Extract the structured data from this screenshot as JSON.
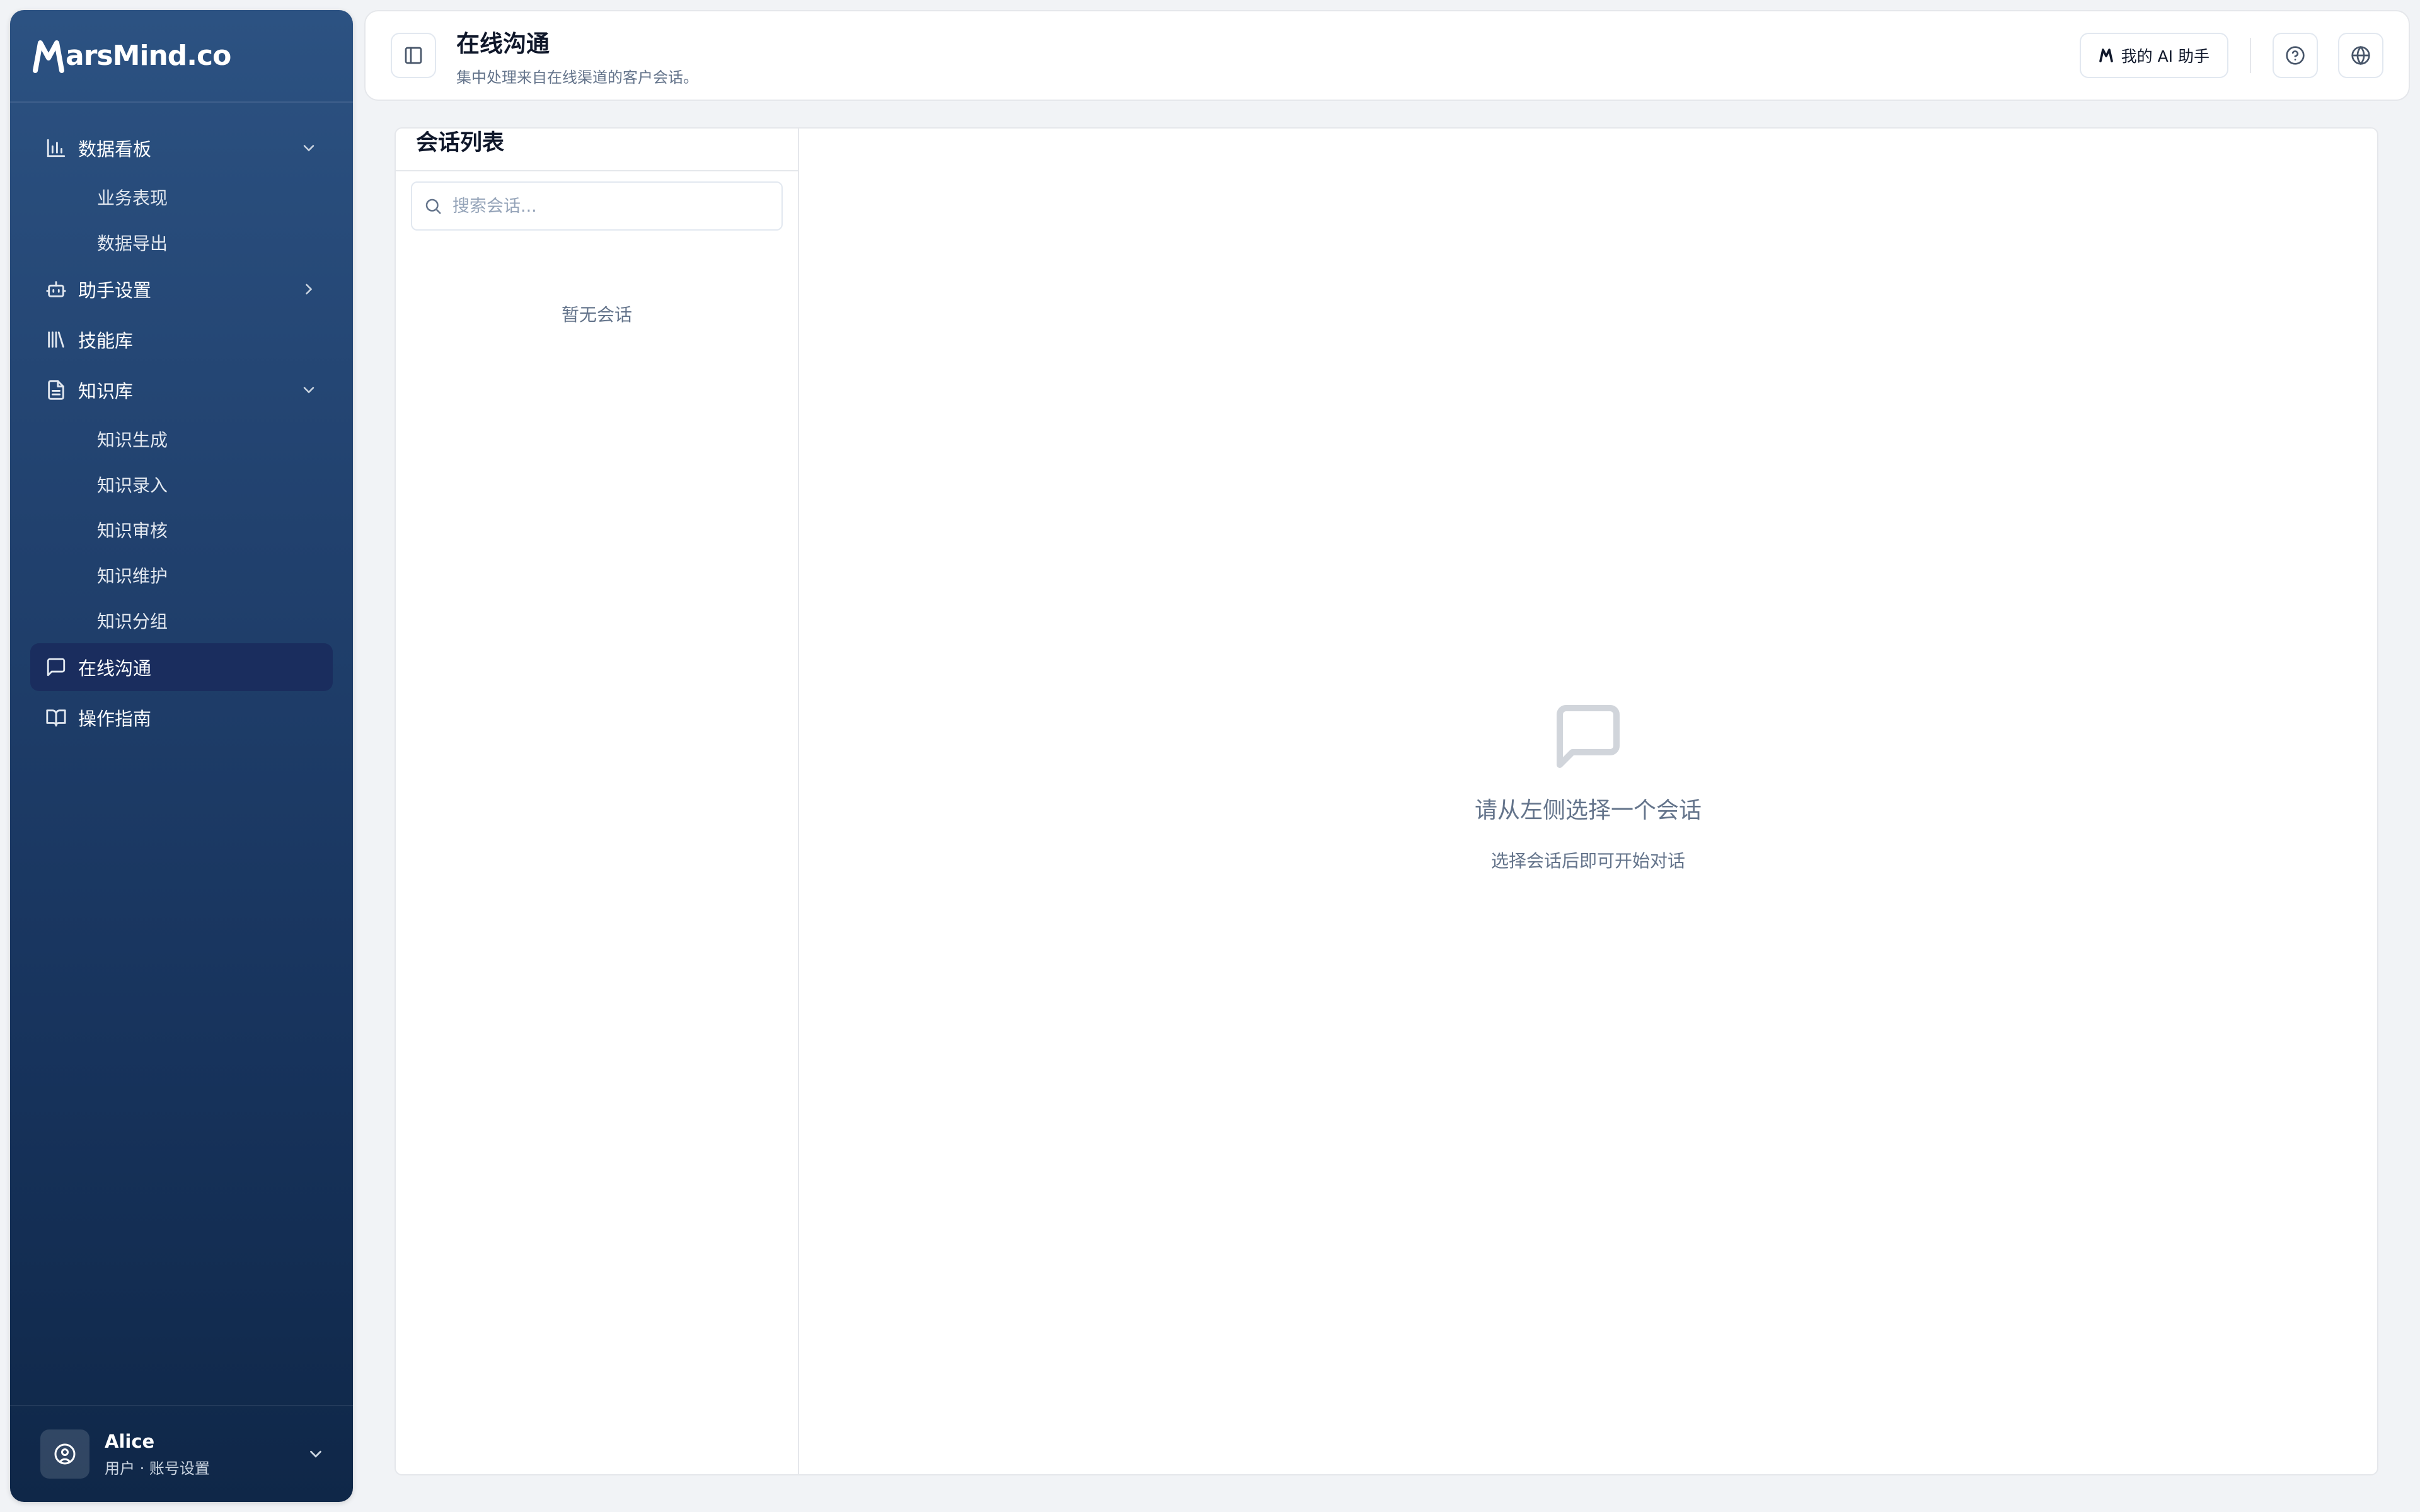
{
  "brand": {
    "logo_text": "arsMind.co"
  },
  "sidebar": {
    "items": [
      {
        "label": "数据看板",
        "icon": "bar-chart-icon",
        "expanded": true,
        "children": [
          {
            "label": "业务表现"
          },
          {
            "label": "数据导出"
          }
        ]
      },
      {
        "label": "助手设置",
        "icon": "bot-icon",
        "expanded": false
      },
      {
        "label": "技能库",
        "icon": "library-icon"
      },
      {
        "label": "知识库",
        "icon": "file-text-icon",
        "expanded": true,
        "children": [
          {
            "label": "知识生成"
          },
          {
            "label": "知识录入"
          },
          {
            "label": "知识审核"
          },
          {
            "label": "知识维护"
          },
          {
            "label": "知识分组"
          }
        ]
      },
      {
        "label": "在线沟通",
        "icon": "message-square-icon",
        "active": true
      },
      {
        "label": "操作指南",
        "icon": "book-open-icon"
      }
    ]
  },
  "user": {
    "name": "Alice",
    "role": "用户 · 账号设置"
  },
  "header": {
    "title": "在线沟通",
    "subtitle": "集中处理来自在线渠道的客户会话。",
    "ai_button": "我的 AI 助手"
  },
  "conversations": {
    "title": "会话列表",
    "search_placeholder": "搜索会话...",
    "empty_text": "暂无会话"
  },
  "chat": {
    "empty_title": "请从左侧选择一个会话",
    "empty_sub": "选择会话后即可开始对话"
  },
  "colors": {
    "sidebar_top": "#2c5282",
    "sidebar_bottom": "#0f2748",
    "active_item": "#1a2d5e",
    "page_bg": "#f1f3f6"
  }
}
